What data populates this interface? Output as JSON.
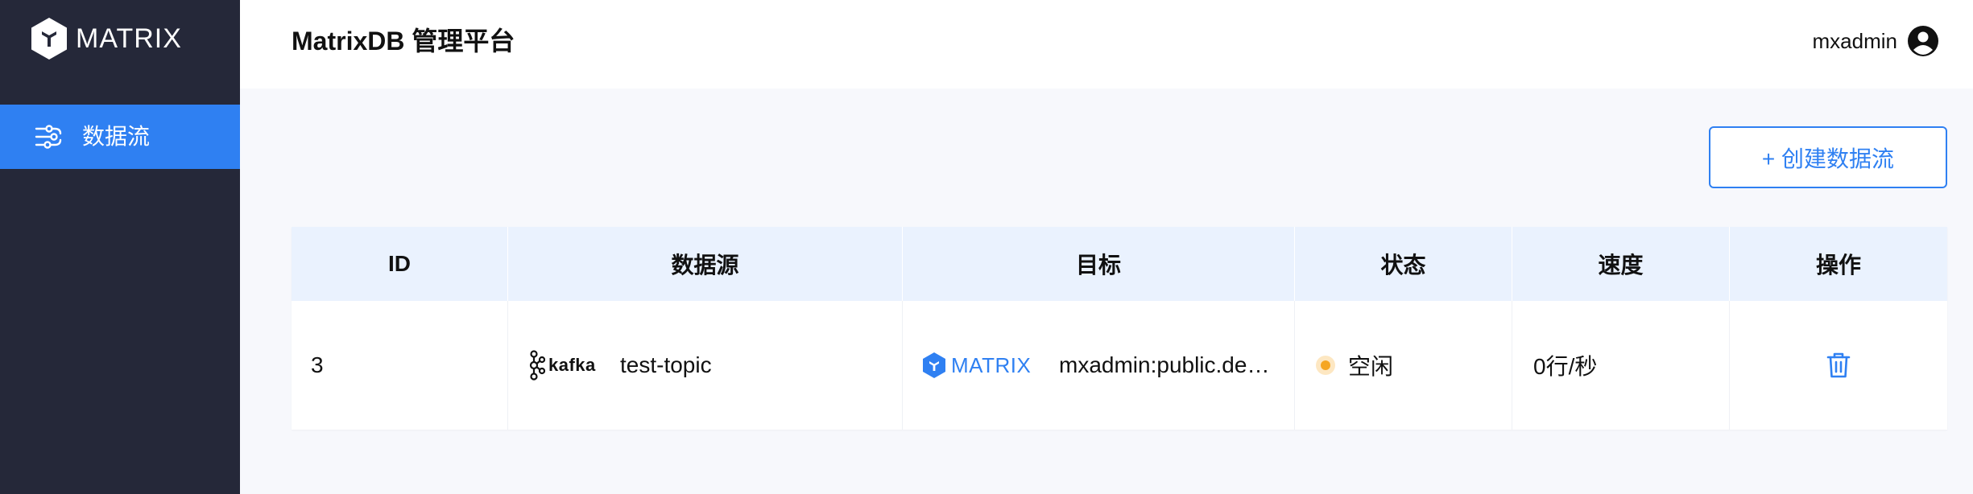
{
  "brand": {
    "name": "MATRIX",
    "icon": "matrix-cube-logo"
  },
  "sidebar": {
    "items": [
      {
        "label": "数据流",
        "icon": "data-flow-icon",
        "active": true
      }
    ]
  },
  "header": {
    "title": "MatrixDB 管理平台",
    "user": {
      "name": "mxadmin",
      "icon": "user-circle-icon"
    }
  },
  "toolbar": {
    "create_label": "+ 创建数据流"
  },
  "table": {
    "columns": [
      "ID",
      "数据源",
      "目标",
      "状态",
      "速度",
      "操作"
    ],
    "rows": [
      {
        "id": "3",
        "source_logo": "kafka",
        "source": "test-topic",
        "target_logo": "MATRIX",
        "target": "mxadmin:public.de…",
        "status": "空闲",
        "speed": "0行/秒",
        "action_icon": "trash-icon"
      }
    ]
  },
  "colors": {
    "sidebar_bg": "#252839",
    "accent": "#2f80f2",
    "header_row_bg": "#eaf2fe",
    "status_idle": "#f5a623"
  }
}
